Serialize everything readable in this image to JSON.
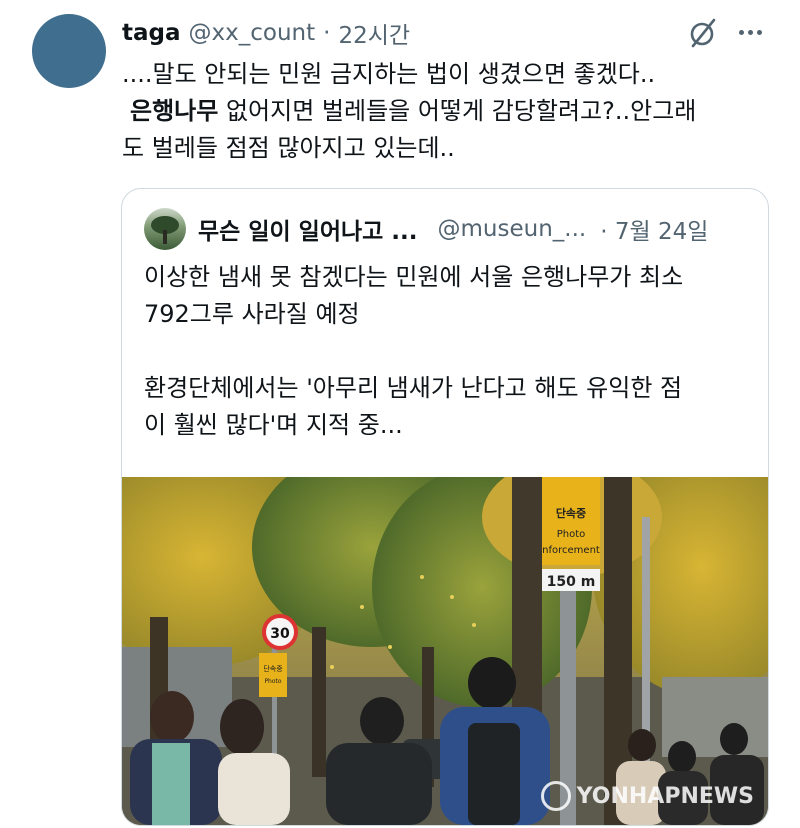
{
  "tweet": {
    "author_name": "taga",
    "author_handle": "@xx_count",
    "separator": "·",
    "time": "22시간",
    "line1": "....말도 안되는 민원 금지하는 법이 생겼으면 좋겠다..",
    "keyword": "은행나무",
    "line2_rest": " 없어지면 벌레들을 어떻게 감당할려고?..안그래",
    "line3": "도 벌레들 점점 많아지고 있는데..",
    "icons": {
      "avatar": "avatar",
      "hide": "eye-slash-icon",
      "more": "more-icon"
    }
  },
  "quote": {
    "author_name": "무슨 일이 일어나고 ...",
    "author_handle": "@museun_...",
    "date": "· 7월 24일",
    "line1": "이상한 냄새 못 참겠다는 민원에 서울 은행나무가 최소",
    "line2": "792그루 사라질 예정",
    "line3": "환경단체에서는 '아무리 냄새가 난다고 해도 유익한 점",
    "line4": "이 훨씬 많다'며 지적 중...",
    "photo": {
      "sign_top": "단속중",
      "sign_photo": "Photo",
      "sign_enforcement": "nforcement",
      "sign_distance": "150 m",
      "speed_limit": "30",
      "small_sign_top": "단속중",
      "small_sign_photo": "Photo",
      "watermark": "YONHAPNEWS"
    }
  },
  "colors": {
    "text": "#0f1419",
    "muted": "#536471",
    "border": "#cfd9de",
    "avatar": "#3f6e8e"
  }
}
